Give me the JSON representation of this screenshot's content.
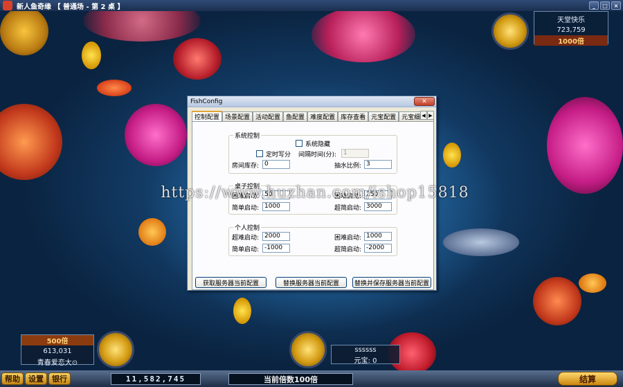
{
  "window": {
    "title": "新人鱼奇缘 【 普通场 - 第 2 桌 】",
    "minimize": "_",
    "maximize": "□",
    "close": "×"
  },
  "top_player": {
    "name": "天堂快乐",
    "score": "723,759",
    "bet": "1000倍"
  },
  "left_player": {
    "bet": "500倍",
    "score": "613,031",
    "name": "青春爱恋大⊙"
  },
  "right_player": {
    "name": "ssssss",
    "yuanbao": "元宝: 0"
  },
  "bottom_bar": {
    "help": "帮助",
    "settings": "设置",
    "bank": "银行",
    "score": "11,582,745",
    "rate": "当前倍数100倍",
    "settle": "结算"
  },
  "watermark": "https://www.huzhan.com/ishop15818",
  "dialog": {
    "title": "FishConfig",
    "close": "✕",
    "tabs": [
      "控制配置",
      "场景配置",
      "活动配置",
      "鱼配置",
      "难度配置",
      "库存查看",
      "元宝配置",
      "元宝细节配"
    ],
    "tab_prev": "◀",
    "tab_next": "▶",
    "system": {
      "title": "系统控制",
      "hide_label": "系统隐藏",
      "timed_label": "定时写分",
      "interval_label": "间隔时间(分):",
      "interval_value": "1",
      "stock_label": "房间库存:",
      "stock_value": "0",
      "pump_label": "抽水比例:",
      "pump_value": "3"
    },
    "table": {
      "title": "桌子控制",
      "hard_label": "困难启动:",
      "hard_value": "50",
      "difficult_label": "困难启动:",
      "difficult_value": "250",
      "easy_label": "简单启动:",
      "easy_value": "1000",
      "super_easy_label": "超简启动:",
      "super_easy_value": "3000"
    },
    "personal": {
      "title": "个人控制",
      "super_hard_label": "超难启动:",
      "super_hard_value": "2000",
      "hard_label": "困难启动:",
      "hard_value": "1000",
      "easy_label": "简单启动:",
      "easy_value": "-1000",
      "super_easy_label": "超简启动:",
      "super_easy_value": "-2000"
    },
    "buttons": {
      "fetch": "获取服务器当前配置",
      "replace": "替换服务器当前配置",
      "replace_save": "替换并保存服务器当前配置"
    }
  },
  "colors": {
    "dialog_bg": "#ece9d8",
    "title_bar": "#2f4b76",
    "gold_button": "#f3d164"
  }
}
